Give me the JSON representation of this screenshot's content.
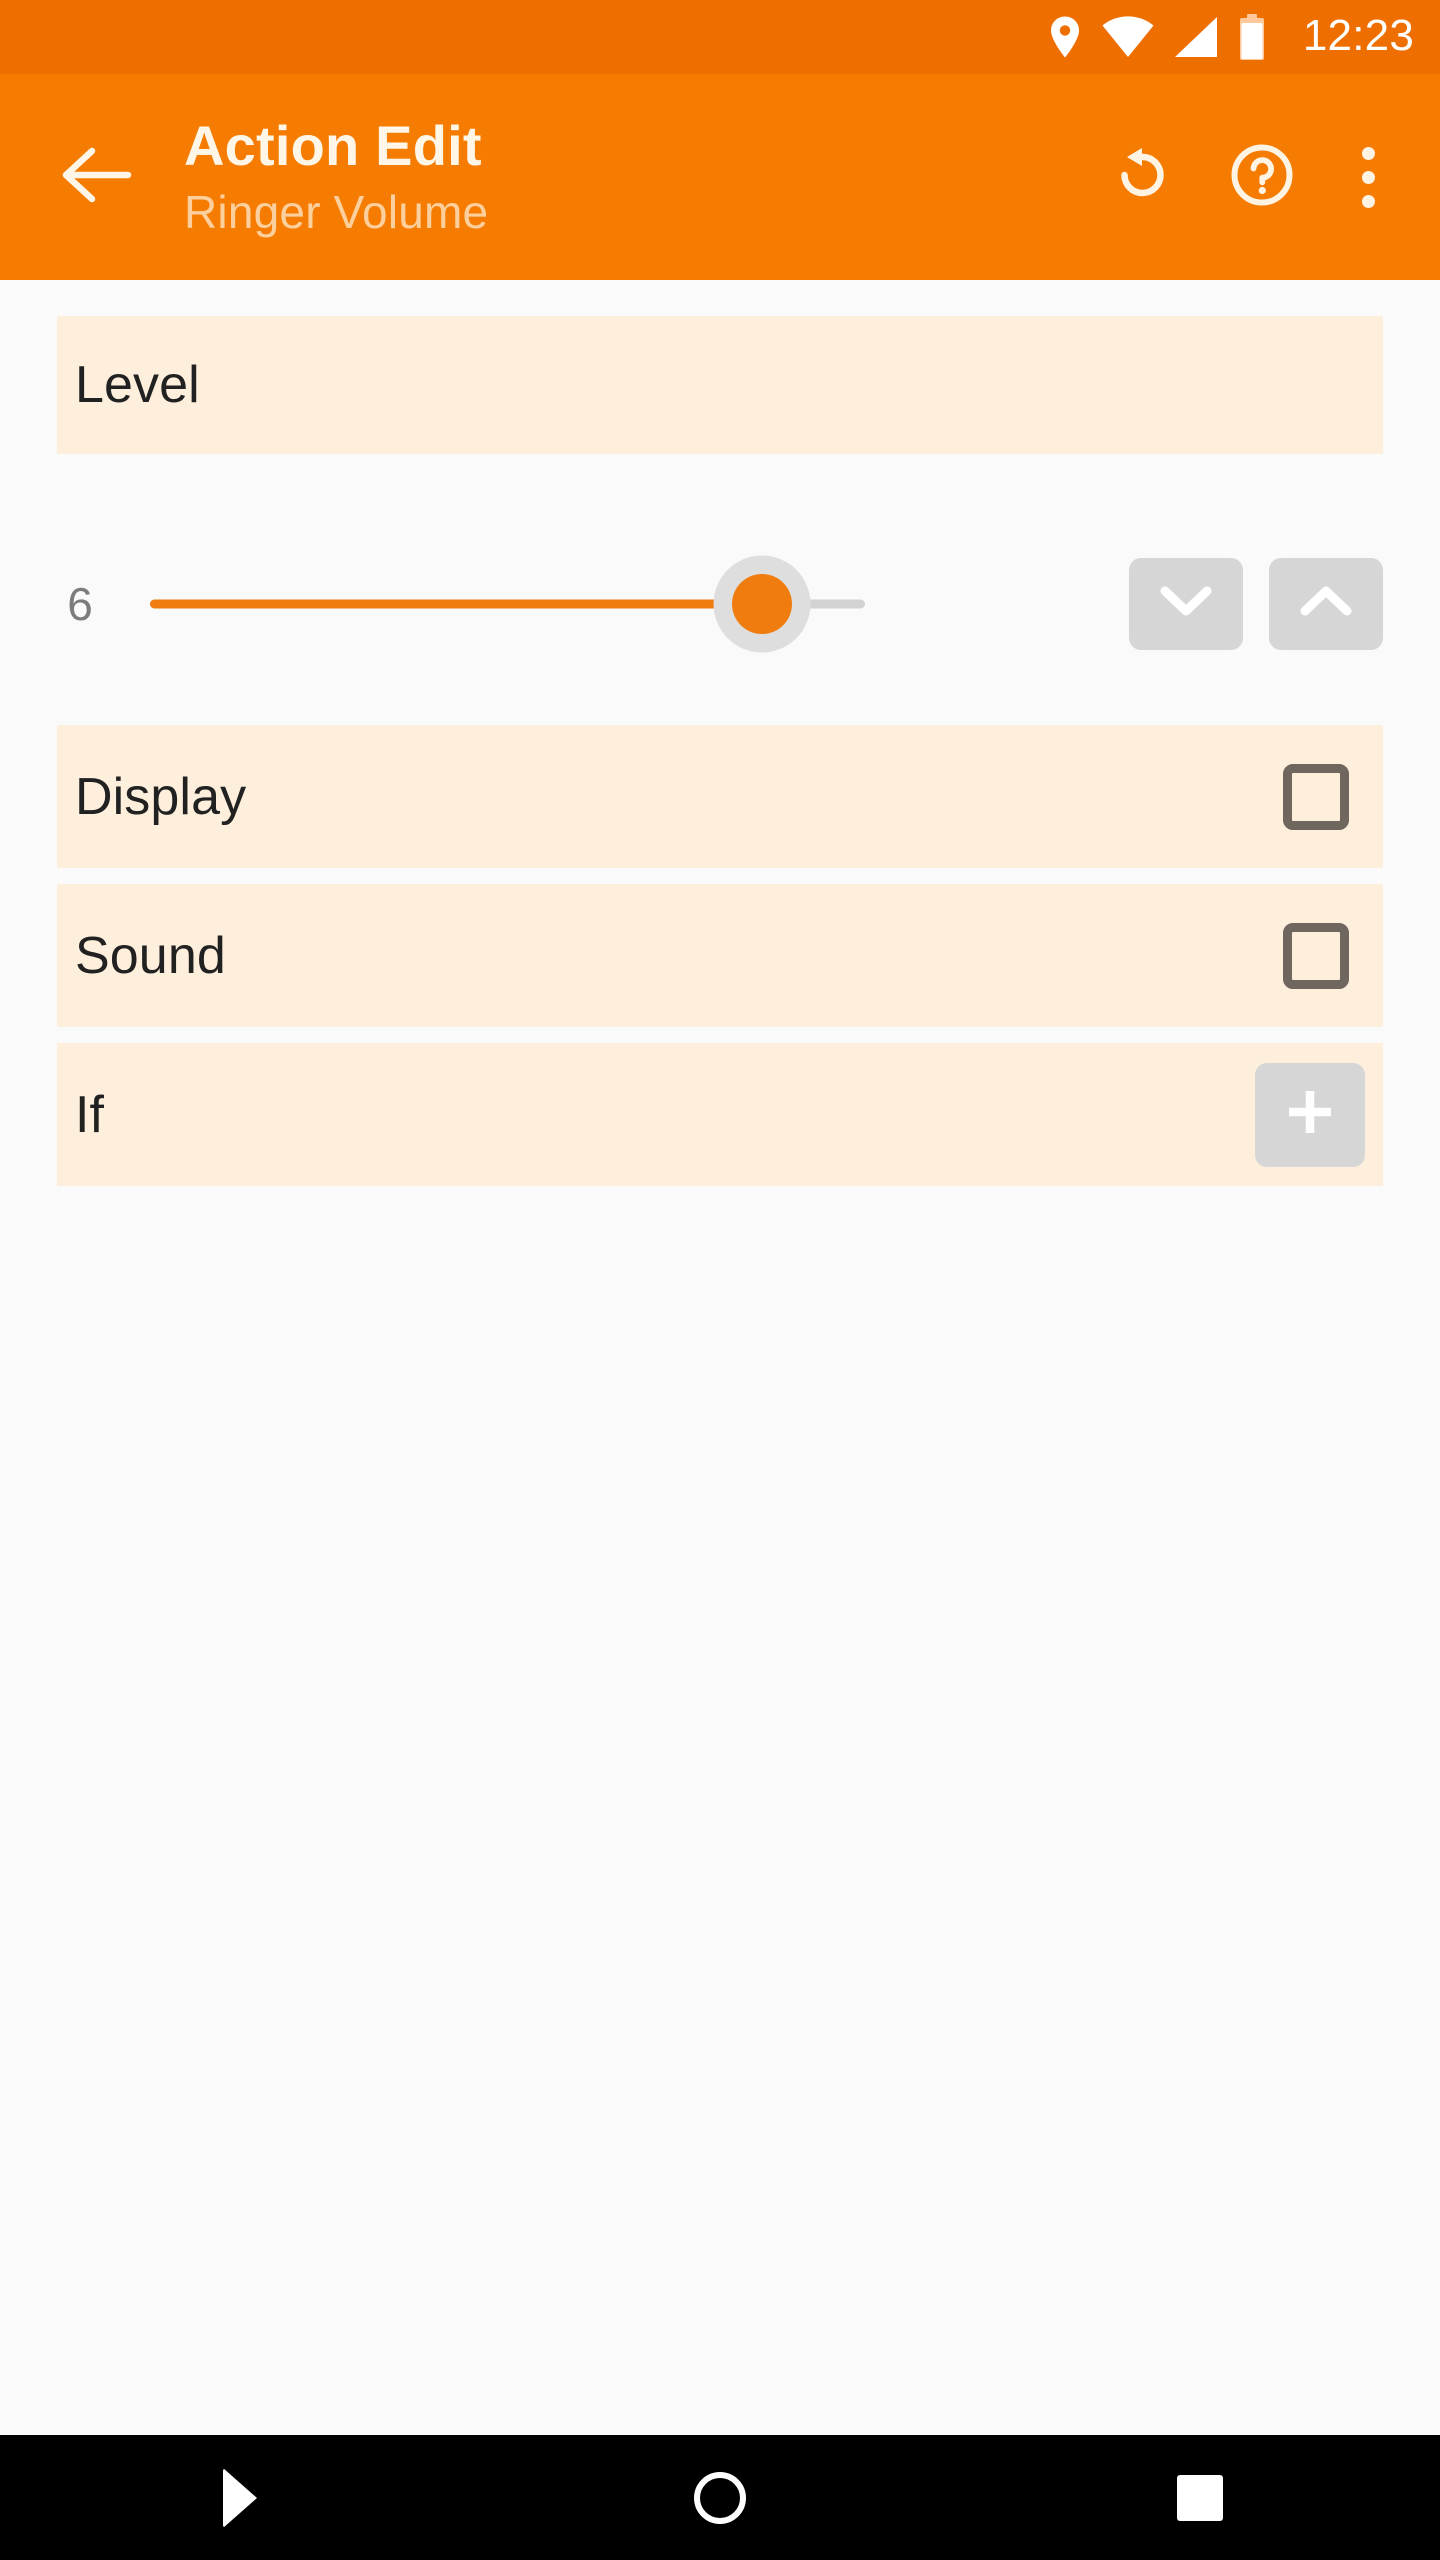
{
  "status_bar": {
    "clock": "12:23",
    "icons": [
      "location-pin-icon",
      "wifi-icon",
      "cell-signal-icon",
      "battery-icon"
    ],
    "background": "#EE6F00"
  },
  "app_bar": {
    "background": "#F57C00",
    "back_icon": "back-arrow-icon",
    "title": "Action Edit",
    "subtitle": "Ringer Volume",
    "actions": [
      {
        "name": "undo-icon",
        "label": "Undo"
      },
      {
        "name": "help-icon",
        "label": "Help"
      },
      {
        "name": "overflow-menu-icon",
        "label": "More options"
      }
    ]
  },
  "content": {
    "level_section": {
      "header": "Level",
      "value": "6",
      "slider": {
        "min": 0,
        "max": 7,
        "current": 6,
        "fill_color": "#F07C10",
        "track_color": "#D3D3D3"
      },
      "decrement_icon": "chevron-down-icon",
      "increment_icon": "chevron-up-icon"
    },
    "options": [
      {
        "label": "Display",
        "control": "checkbox",
        "checked": false
      },
      {
        "label": "Sound",
        "control": "checkbox",
        "checked": false
      }
    ],
    "if_section": {
      "label": "If",
      "add_icon": "plus-icon"
    },
    "row_background": "#FDEFDC",
    "page_background": "#FAFAFA"
  },
  "nav_bar": {
    "background": "#000000",
    "buttons": [
      {
        "name": "nav-back-icon",
        "label": "Back"
      },
      {
        "name": "nav-home-icon",
        "label": "Home"
      },
      {
        "name": "nav-recents-icon",
        "label": "Recents"
      }
    ]
  }
}
